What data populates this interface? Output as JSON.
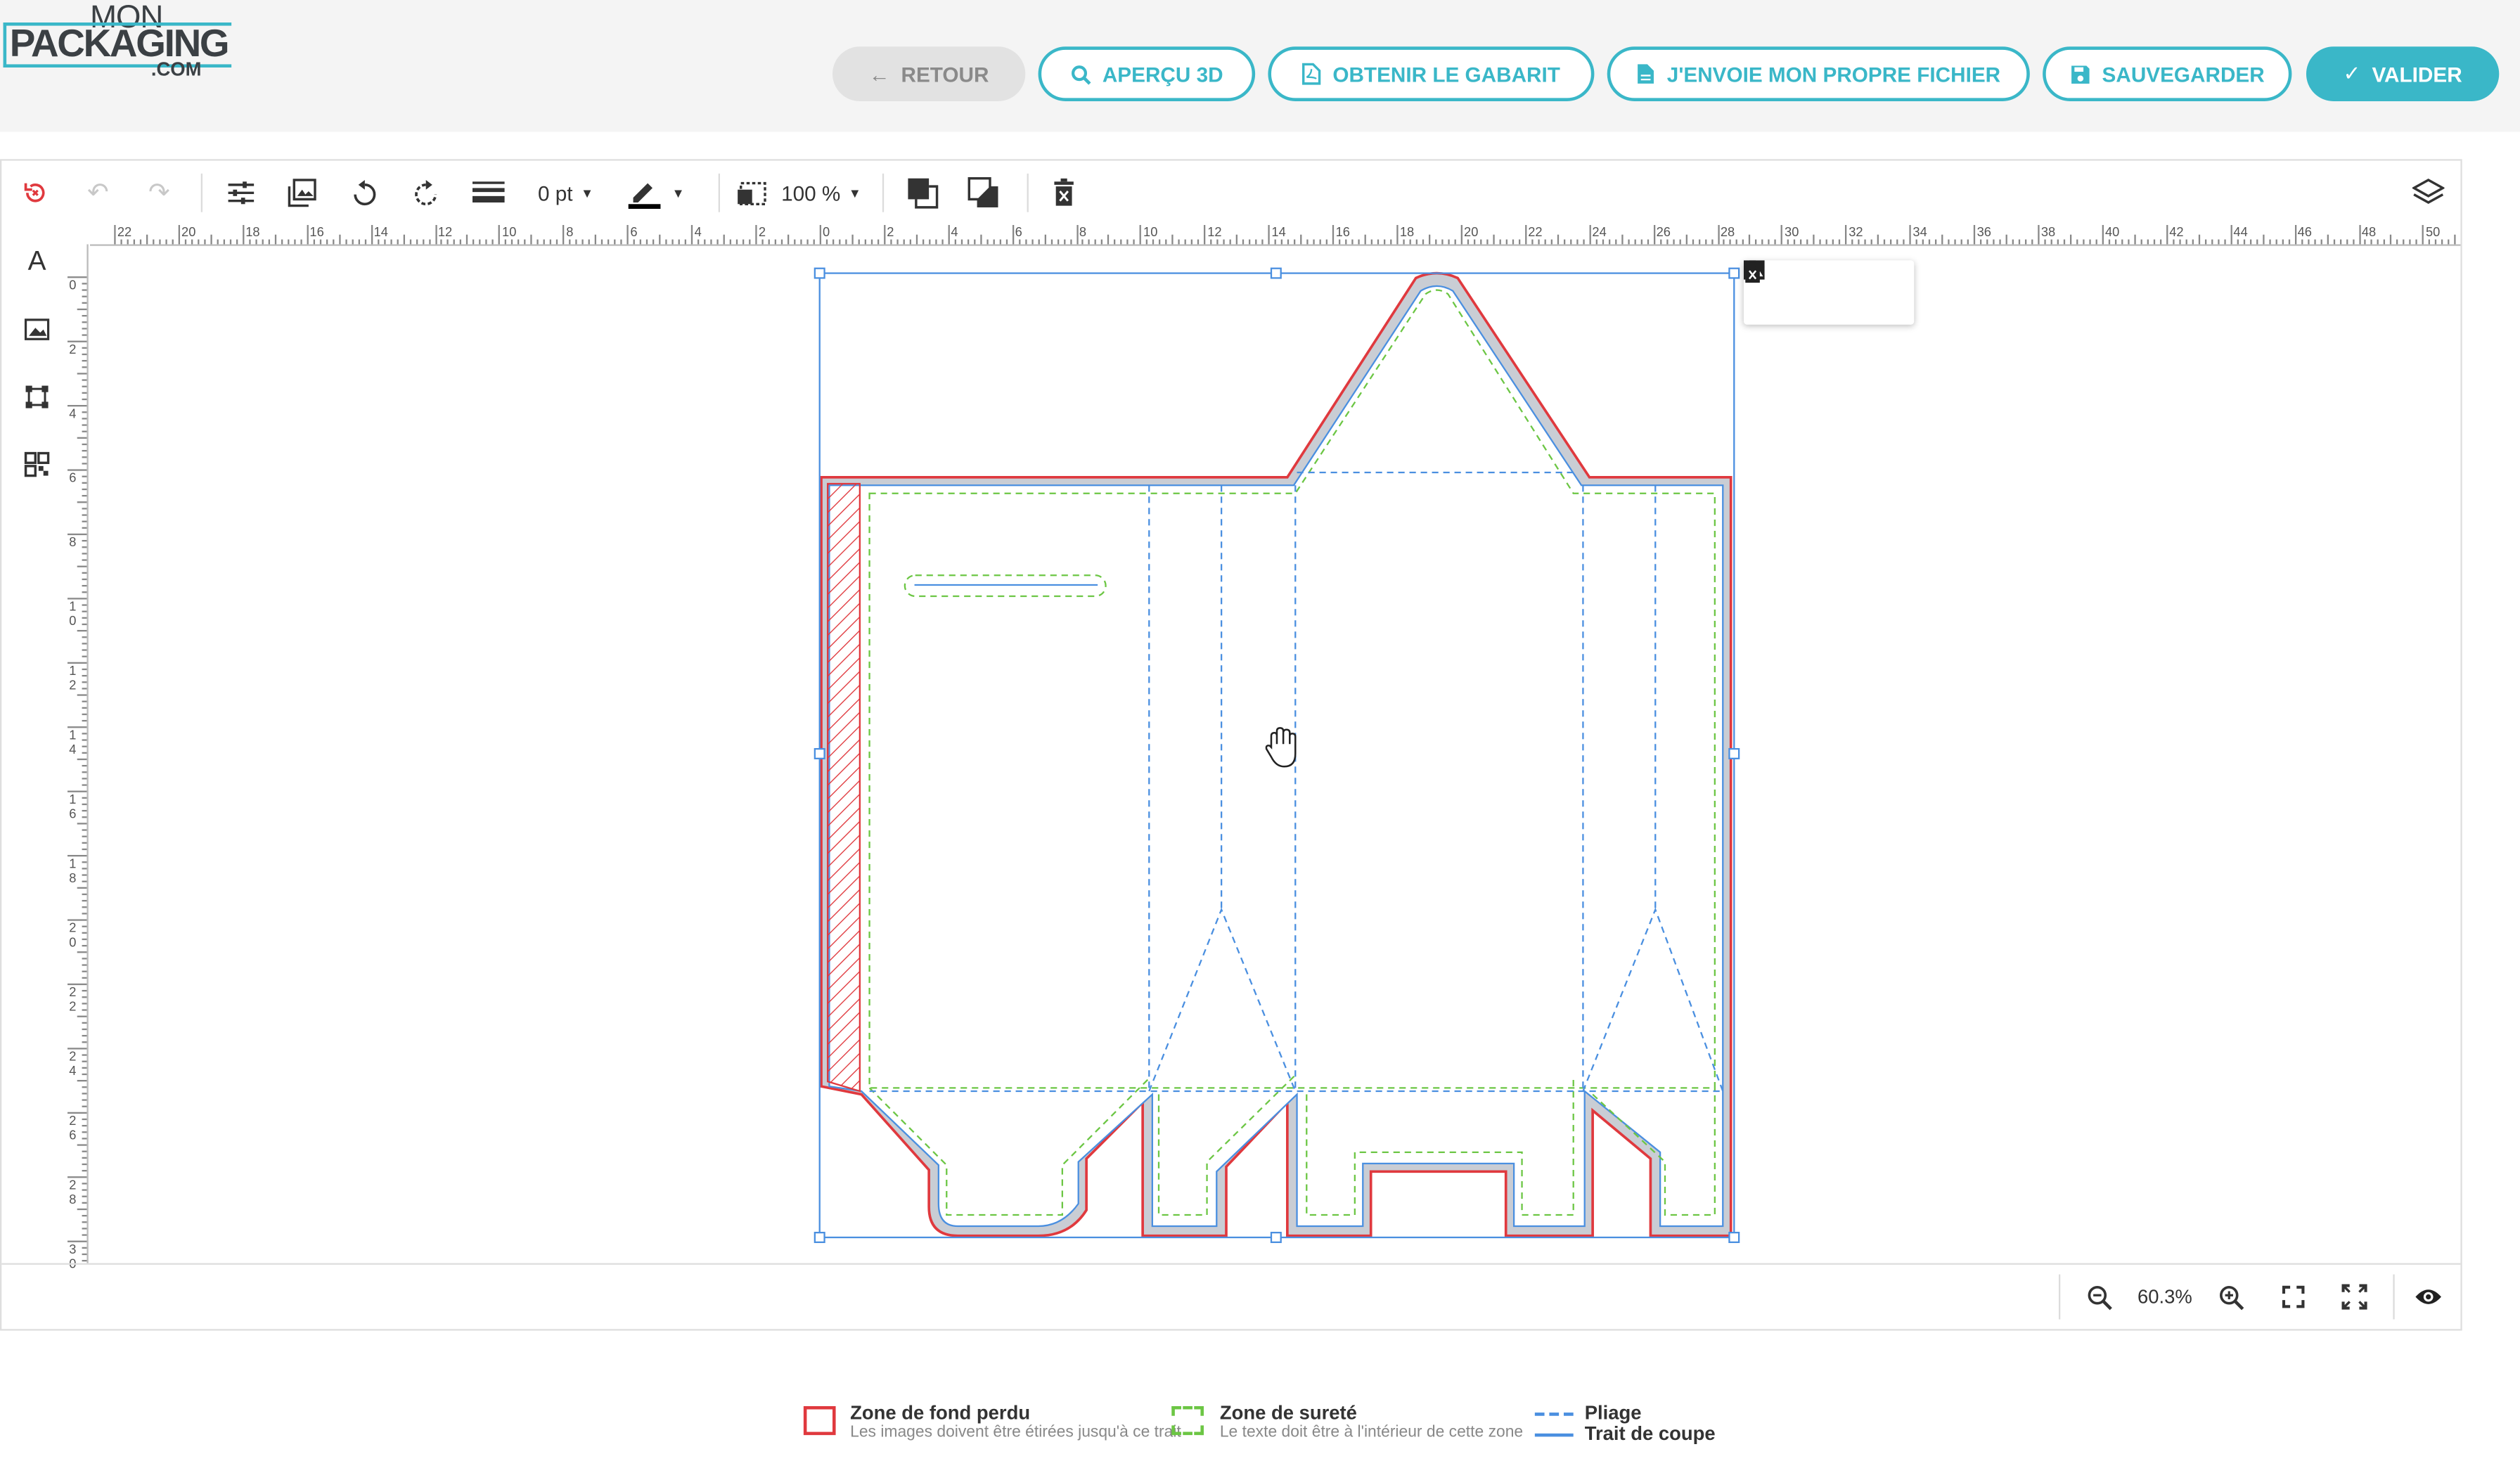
{
  "logo": {
    "line1": "MON",
    "line2": "PACKAGING",
    "line3": ".COM"
  },
  "header": {
    "buttons": {
      "retour": "RETOUR",
      "apercu": "APERÇU 3D",
      "gabarit": "OBTENIR LE GABARIT",
      "fichier": "J'ENVOIE MON PROPRE FICHIER",
      "sauvegarder": "SAUVEGARDER",
      "valider": "VALIDER"
    }
  },
  "toolbar": {
    "stroke_width": "0 pt",
    "opacity": "100 %"
  },
  "rulers": {
    "horizontal": [
      "22",
      "20",
      "18",
      "16",
      "14",
      "12",
      "10",
      "8",
      "6",
      "4",
      "2",
      "0",
      "2",
      "4",
      "6",
      "8",
      "10",
      "12",
      "14",
      "16",
      "18",
      "20",
      "22",
      "24",
      "26",
      "28",
      "30",
      "32",
      "34",
      "36",
      "38",
      "40",
      "42",
      "44",
      "46",
      "48",
      "50"
    ],
    "vertical": [
      "0",
      "2",
      "4",
      "6",
      "8",
      "10",
      "12",
      "14",
      "16",
      "18",
      "20",
      "22",
      "24",
      "26",
      "28",
      "30"
    ]
  },
  "zoom": {
    "level": "60.3%"
  },
  "legend": {
    "bleed": {
      "title": "Zone de fond perdu",
      "subtitle": "Les images doivent être étirées jusqu'à ce trait"
    },
    "safe": {
      "title": "Zone de sureté",
      "subtitle": "Le texte doit être à l'intérieur de cette zone"
    },
    "fold": "Pliage",
    "cut": "Trait de coupe"
  },
  "colors": {
    "accent": "#3ab7c8",
    "bleed": "#e0393e",
    "safe": "#6cc644",
    "fold": "#4a8fe0"
  },
  "icons": {
    "toolbar": [
      "reset-icon",
      "undo-icon",
      "redo-icon",
      "adjust-icon",
      "image-replace-icon",
      "rotate-left-icon",
      "rotate-right-icon",
      "line-weight-icon",
      "stroke-color-icon",
      "opacity-icon",
      "bring-front-icon",
      "send-back-icon",
      "delete-icon",
      "layers-icon"
    ],
    "left": [
      "text-icon",
      "image-icon",
      "shape-icon",
      "qrcode-icon"
    ],
    "bottom": [
      "zoom-out-icon",
      "zoom-in-icon",
      "fit-icon",
      "fullscreen-icon",
      "preview-icon"
    ]
  }
}
